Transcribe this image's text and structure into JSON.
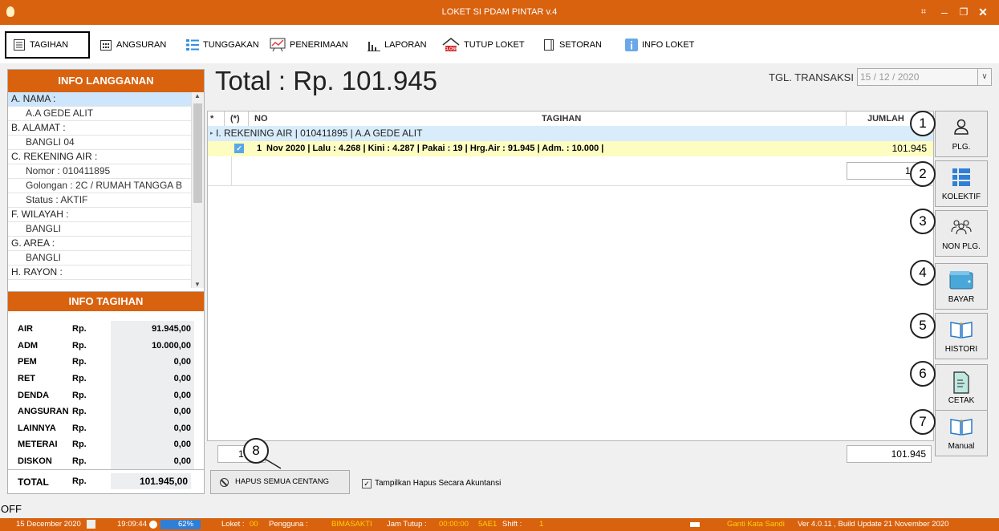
{
  "window": {
    "title": "LOKET SI PDAM PINTAR v.4"
  },
  "toolbar": [
    {
      "label": "TAGIHAN",
      "icon": "bill-icon"
    },
    {
      "label": "ANGSURAN",
      "icon": "calendar-icon"
    },
    {
      "label": "TUNGGAKAN",
      "icon": "list-icon"
    },
    {
      "label": "PENERIMAAN",
      "icon": "chart-board-icon"
    },
    {
      "label": "LAPORAN",
      "icon": "bar-chart-icon"
    },
    {
      "label": "TUTUP LOKET",
      "icon": "close-house-icon"
    },
    {
      "label": "SETORAN",
      "icon": "notebook-icon"
    },
    {
      "label": "INFO LOKET",
      "icon": "info-icon"
    }
  ],
  "info_langganan": {
    "title": "INFO LANGGANAN",
    "rows": [
      {
        "text": "A. NAMA :",
        "indent": false
      },
      {
        "text": "A.A GEDE ALIT",
        "indent": true
      },
      {
        "text": "B. ALAMAT :",
        "indent": false
      },
      {
        "text": "BANGLI 04",
        "indent": true
      },
      {
        "text": "C. REKENING AIR :",
        "indent": false
      },
      {
        "text": "Nomor  :  010411895",
        "indent": true
      },
      {
        "text": "Golongan  :  2C / RUMAH TANGGA B",
        "indent": true
      },
      {
        "text": "Status  :  AKTIF",
        "indent": true
      },
      {
        "text": "F. WILAYAH :",
        "indent": false
      },
      {
        "text": "BANGLI",
        "indent": true
      },
      {
        "text": "G. AREA :",
        "indent": false
      },
      {
        "text": "BANGLI",
        "indent": true
      },
      {
        "text": "H. RAYON :",
        "indent": false
      }
    ]
  },
  "info_tagihan": {
    "title": "INFO TAGIHAN",
    "currency": "Rp.",
    "items": [
      {
        "label": "AIR",
        "value": "91.945,00"
      },
      {
        "label": "ADM",
        "value": "10.000,00"
      },
      {
        "label": "PEM",
        "value": "0,00"
      },
      {
        "label": "RET",
        "value": "0,00"
      },
      {
        "label": "DENDA",
        "value": "0,00"
      },
      {
        "label": "ANGSURAN",
        "value": "0,00"
      },
      {
        "label": "LAINNYA",
        "value": "0,00"
      },
      {
        "label": "METERAI",
        "value": "0,00"
      },
      {
        "label": "DISKON",
        "value": "0,00"
      }
    ],
    "total_label": "TOTAL",
    "total_value": "101.945,00"
  },
  "main": {
    "total": "Total :  Rp. 101.945",
    "tgl_label": "TGL. TRANSAKSI",
    "tgl_value": "15 / 12 / 2020"
  },
  "grid": {
    "headers": {
      "star": "*",
      "check": "(*)",
      "no": "NO",
      "tagihan": "TAGIHAN",
      "jumlah": "JUMLAH"
    },
    "group": "I. REKENING AIR | 010411895   |   A.A GEDE ALIT",
    "row": {
      "no": "1",
      "text": "Nov 2020 | Lalu : 4.268 | Kini : 4.287 | Pakai : 19 | Hrg.Air : 91.945 |  Adm. : 10.000 |",
      "jumlah": "101.945",
      "check": "✓"
    },
    "subtotal": "101",
    "footer_count": "1",
    "footer_total": "101.945"
  },
  "side_buttons": [
    {
      "label": "PLG.",
      "icon": "person-icon",
      "num": "1"
    },
    {
      "label": "KOLEKTIF",
      "icon": "grid-icon",
      "num": "2"
    },
    {
      "label": "NON PLG.",
      "icon": "group-icon",
      "num": "3"
    },
    {
      "label": "BAYAR",
      "icon": "wallet-icon",
      "num": "4"
    },
    {
      "label": "HISTORI",
      "icon": "book-icon",
      "num": "5"
    },
    {
      "label": "CETAK",
      "icon": "document-icon",
      "num": "6"
    },
    {
      "label": "Manual",
      "icon": "manual-book-icon",
      "num": "7"
    }
  ],
  "bottom": {
    "hapus_label": "HAPUS SEMUA CENTANG",
    "num": "8",
    "checkbox_label": "Tampilkan Hapus Secara Akuntansi",
    "checkbox_mark": "✓",
    "off": "OFF"
  },
  "status": {
    "date": "15 December 2020",
    "time": "19:09:44",
    "percent": "62%",
    "loket_label": "Loket :",
    "loket": "00",
    "pengguna_label": "Pengguna :",
    "pengguna": "BIMASAKTI",
    "jamtutup_label": "Jam Tutup :",
    "jamtutup": "00:00:00",
    "code": "5AE1",
    "shift_label": "Shift :",
    "shift": "1",
    "ganti": "Ganti Kata Sandi",
    "version": "Ver 4.0.11 , Build Update 21 November 2020"
  }
}
